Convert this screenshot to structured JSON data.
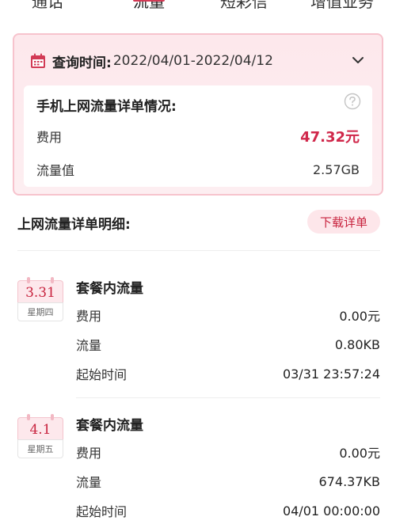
{
  "tabs": [
    {
      "label": "通话"
    },
    {
      "label": "流量"
    },
    {
      "label": "短彩信"
    },
    {
      "label": "增值业务"
    }
  ],
  "query": {
    "label": "查询时间:",
    "range": "2022/04/01-2022/04/12"
  },
  "summary": {
    "title": "手机上网流量详单情况:",
    "fee_label": "费用",
    "fee_value": "47.32元",
    "traffic_label": "流量值",
    "traffic_value": "2.57GB"
  },
  "section": {
    "title": "上网流量详单明细:",
    "download_label": "下载详单"
  },
  "records": [
    {
      "date": "3.31",
      "weekday": "星期四",
      "title": "套餐内流量",
      "fee_label": "费用",
      "fee": "0.00元",
      "traffic_label": "流量",
      "traffic": "0.80KB",
      "start_label": "起始时间",
      "start": "03/31 23:57:24"
    },
    {
      "date": "4.1",
      "weekday": "星期五",
      "title": "套餐内流量",
      "fee_label": "费用",
      "fee": "0.00元",
      "traffic_label": "流量",
      "traffic": "674.37KB",
      "start_label": "起始时间",
      "start": "04/01 00:00:00"
    }
  ],
  "colors": {
    "accent": "#d0274a",
    "card_bg": "#fde8ec",
    "card_border": "#f7c3cd"
  },
  "icons": {
    "calendar": "calendar-icon",
    "chevron": "chevron-down-icon",
    "help": "question-circle-icon"
  }
}
